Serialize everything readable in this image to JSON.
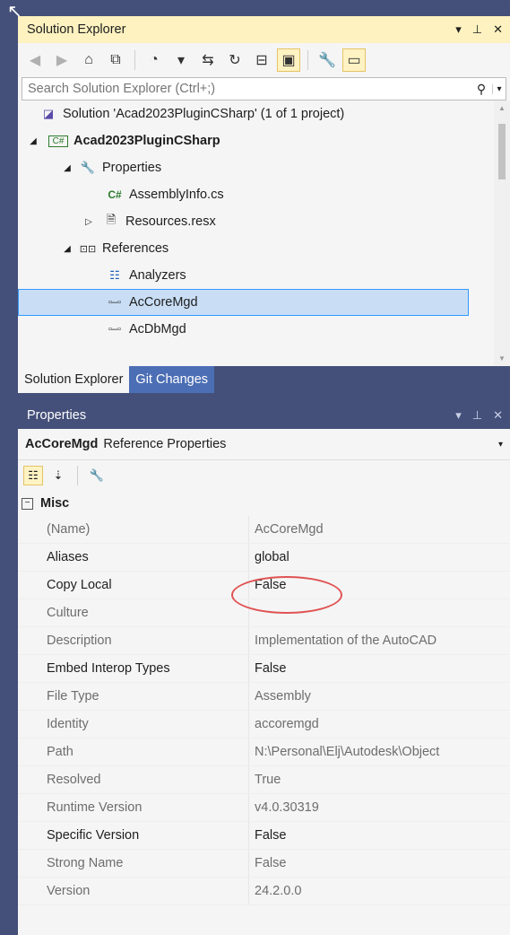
{
  "solution_explorer": {
    "title": "Solution Explorer",
    "search_placeholder": "Search Solution Explorer (Ctrl+;)",
    "tree": [
      {
        "label": "Solution 'Acad2023PluginCSharp' (1 of 1 project)",
        "icon": "solution-icon",
        "arrow": ""
      },
      {
        "label": "Acad2023PluginCSharp",
        "icon": "csharp-project-icon",
        "arrow": "◢",
        "bold": true
      },
      {
        "label": "Properties",
        "icon": "wrench-icon",
        "arrow": "◢"
      },
      {
        "label": "AssemblyInfo.cs",
        "icon": "csharp-file-icon",
        "arrow": ""
      },
      {
        "label": "Resources.resx",
        "icon": "resource-icon",
        "arrow": "▷"
      },
      {
        "label": "References",
        "icon": "references-icon",
        "arrow": "◢"
      },
      {
        "label": "Analyzers",
        "icon": "analyzers-icon",
        "arrow": ""
      },
      {
        "label": "AcCoreMgd",
        "icon": "reference-icon",
        "arrow": "",
        "selected": true
      },
      {
        "label": "AcDbMgd",
        "icon": "reference-icon",
        "arrow": ""
      }
    ],
    "tabs": [
      "Solution Explorer",
      "Git Changes"
    ]
  },
  "properties": {
    "title": "Properties",
    "object_name": "AcCoreMgd",
    "object_type": "Reference Properties",
    "category": "Misc",
    "rows": [
      {
        "key": "(Name)",
        "value": "AcCoreMgd",
        "editable": false
      },
      {
        "key": "Aliases",
        "value": "global",
        "editable": true
      },
      {
        "key": "Copy Local",
        "value": "False",
        "editable": true
      },
      {
        "key": "Culture",
        "value": "",
        "editable": false
      },
      {
        "key": "Description",
        "value": "Implementation of the AutoCAD",
        "editable": false
      },
      {
        "key": "Embed Interop Types",
        "value": "False",
        "editable": true
      },
      {
        "key": "File Type",
        "value": "Assembly",
        "editable": false
      },
      {
        "key": "Identity",
        "value": "accoremgd",
        "editable": false
      },
      {
        "key": "Path",
        "value": "N:\\Personal\\Elj\\Autodesk\\Object",
        "editable": false
      },
      {
        "key": "Resolved",
        "value": "True",
        "editable": false
      },
      {
        "key": "Runtime Version",
        "value": "v4.0.30319",
        "editable": false
      },
      {
        "key": "Specific Version",
        "value": "False",
        "editable": true
      },
      {
        "key": "Strong Name",
        "value": "False",
        "editable": false
      },
      {
        "key": "Version",
        "value": "24.2.0.0",
        "editable": false
      }
    ]
  },
  "colors": {
    "accent": "#44507a",
    "selection": "#c9def5",
    "highlight_oval": "#e05353"
  }
}
